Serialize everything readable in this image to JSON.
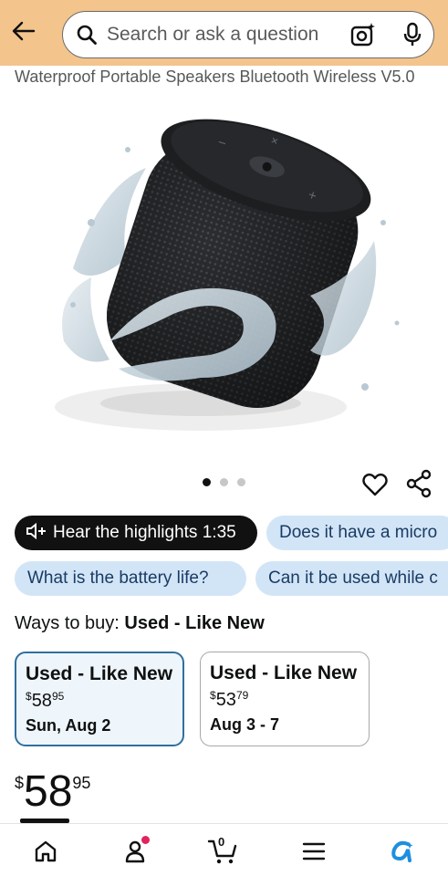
{
  "search": {
    "placeholder": "Search or ask a question"
  },
  "product": {
    "title": "Waterproof Portable Speakers Bluetooth Wireless V5.0",
    "image_count": 3,
    "active_image": 1
  },
  "chips": {
    "highlights": {
      "label": "Hear the highlights",
      "duration": "1:35"
    },
    "questions": [
      "Does it have a micro",
      "What is the battery life?",
      "Can it be used while c"
    ]
  },
  "ways_to_buy": {
    "label": "Ways to buy:",
    "selected": "Used - Like New",
    "options": [
      {
        "title": "Used - Like New",
        "currency": "$",
        "whole": "58",
        "cents": "95",
        "delivery": "Sun, Aug 2"
      },
      {
        "title": "Used - Like New",
        "currency": "$",
        "whole": "53",
        "cents": "79",
        "delivery": "Aug 3 - 7"
      }
    ]
  },
  "price": {
    "currency": "$",
    "whole": "58",
    "cents": "95"
  },
  "nav": {
    "cart_count": "0"
  },
  "colors": {
    "header_bg": "#f3c48c",
    "chip_blue": "#d2e5f7",
    "selected_border": "#2f6f9f",
    "rufus_blue": "#1d8fe0",
    "badge_pink": "#e0245e"
  },
  "icons": [
    "back-arrow-icon",
    "search-icon",
    "camera-icon",
    "mic-icon",
    "heart-icon",
    "share-icon",
    "speaker-icon",
    "home-icon",
    "account-icon",
    "cart-icon",
    "menu-icon",
    "rufus-icon"
  ]
}
